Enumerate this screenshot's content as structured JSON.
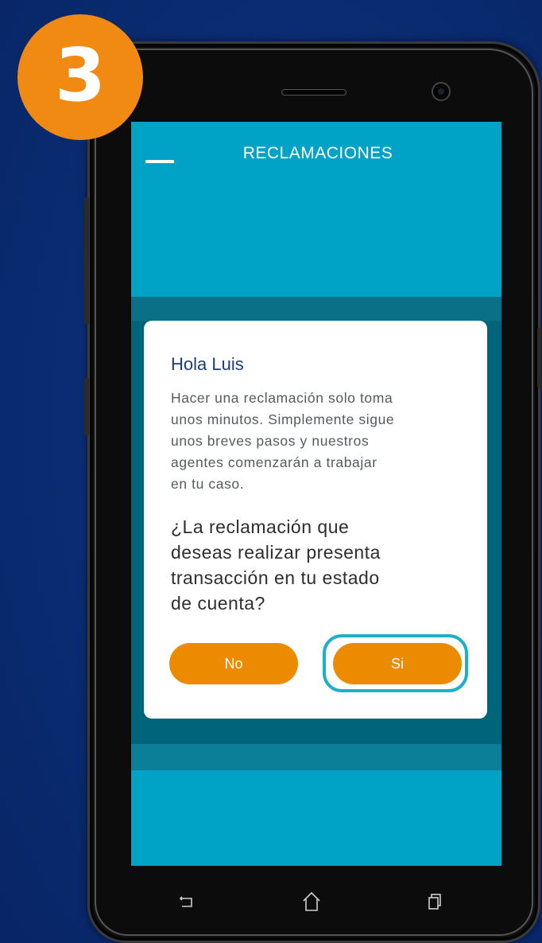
{
  "step_badge": {
    "number": "3",
    "color": "#f08a12"
  },
  "app": {
    "title": "RECLAMACIONES",
    "menu_icon": "menu-icon",
    "screen_color": "#00a2c5"
  },
  "dialog": {
    "greeting": "Hola Luis",
    "body_lines": [
      "Hacer una reclamación solo toma",
      "unos minutos. Simplemente sigue",
      "unos breves pasos y nuestros",
      "agentes comenzarán a trabajar",
      "en tu caso."
    ],
    "question_lines": [
      "¿La reclamación que",
      "deseas realizar presenta",
      "transacción en tu estado",
      "de cuenta?"
    ],
    "buttons": {
      "no_label": "No",
      "si_label": "Si"
    },
    "button_color": "#ec8b00",
    "highlight_color": "#1fb0c7"
  },
  "navbar": {
    "icons": [
      "back-icon",
      "home-icon",
      "recent-apps-icon"
    ]
  }
}
